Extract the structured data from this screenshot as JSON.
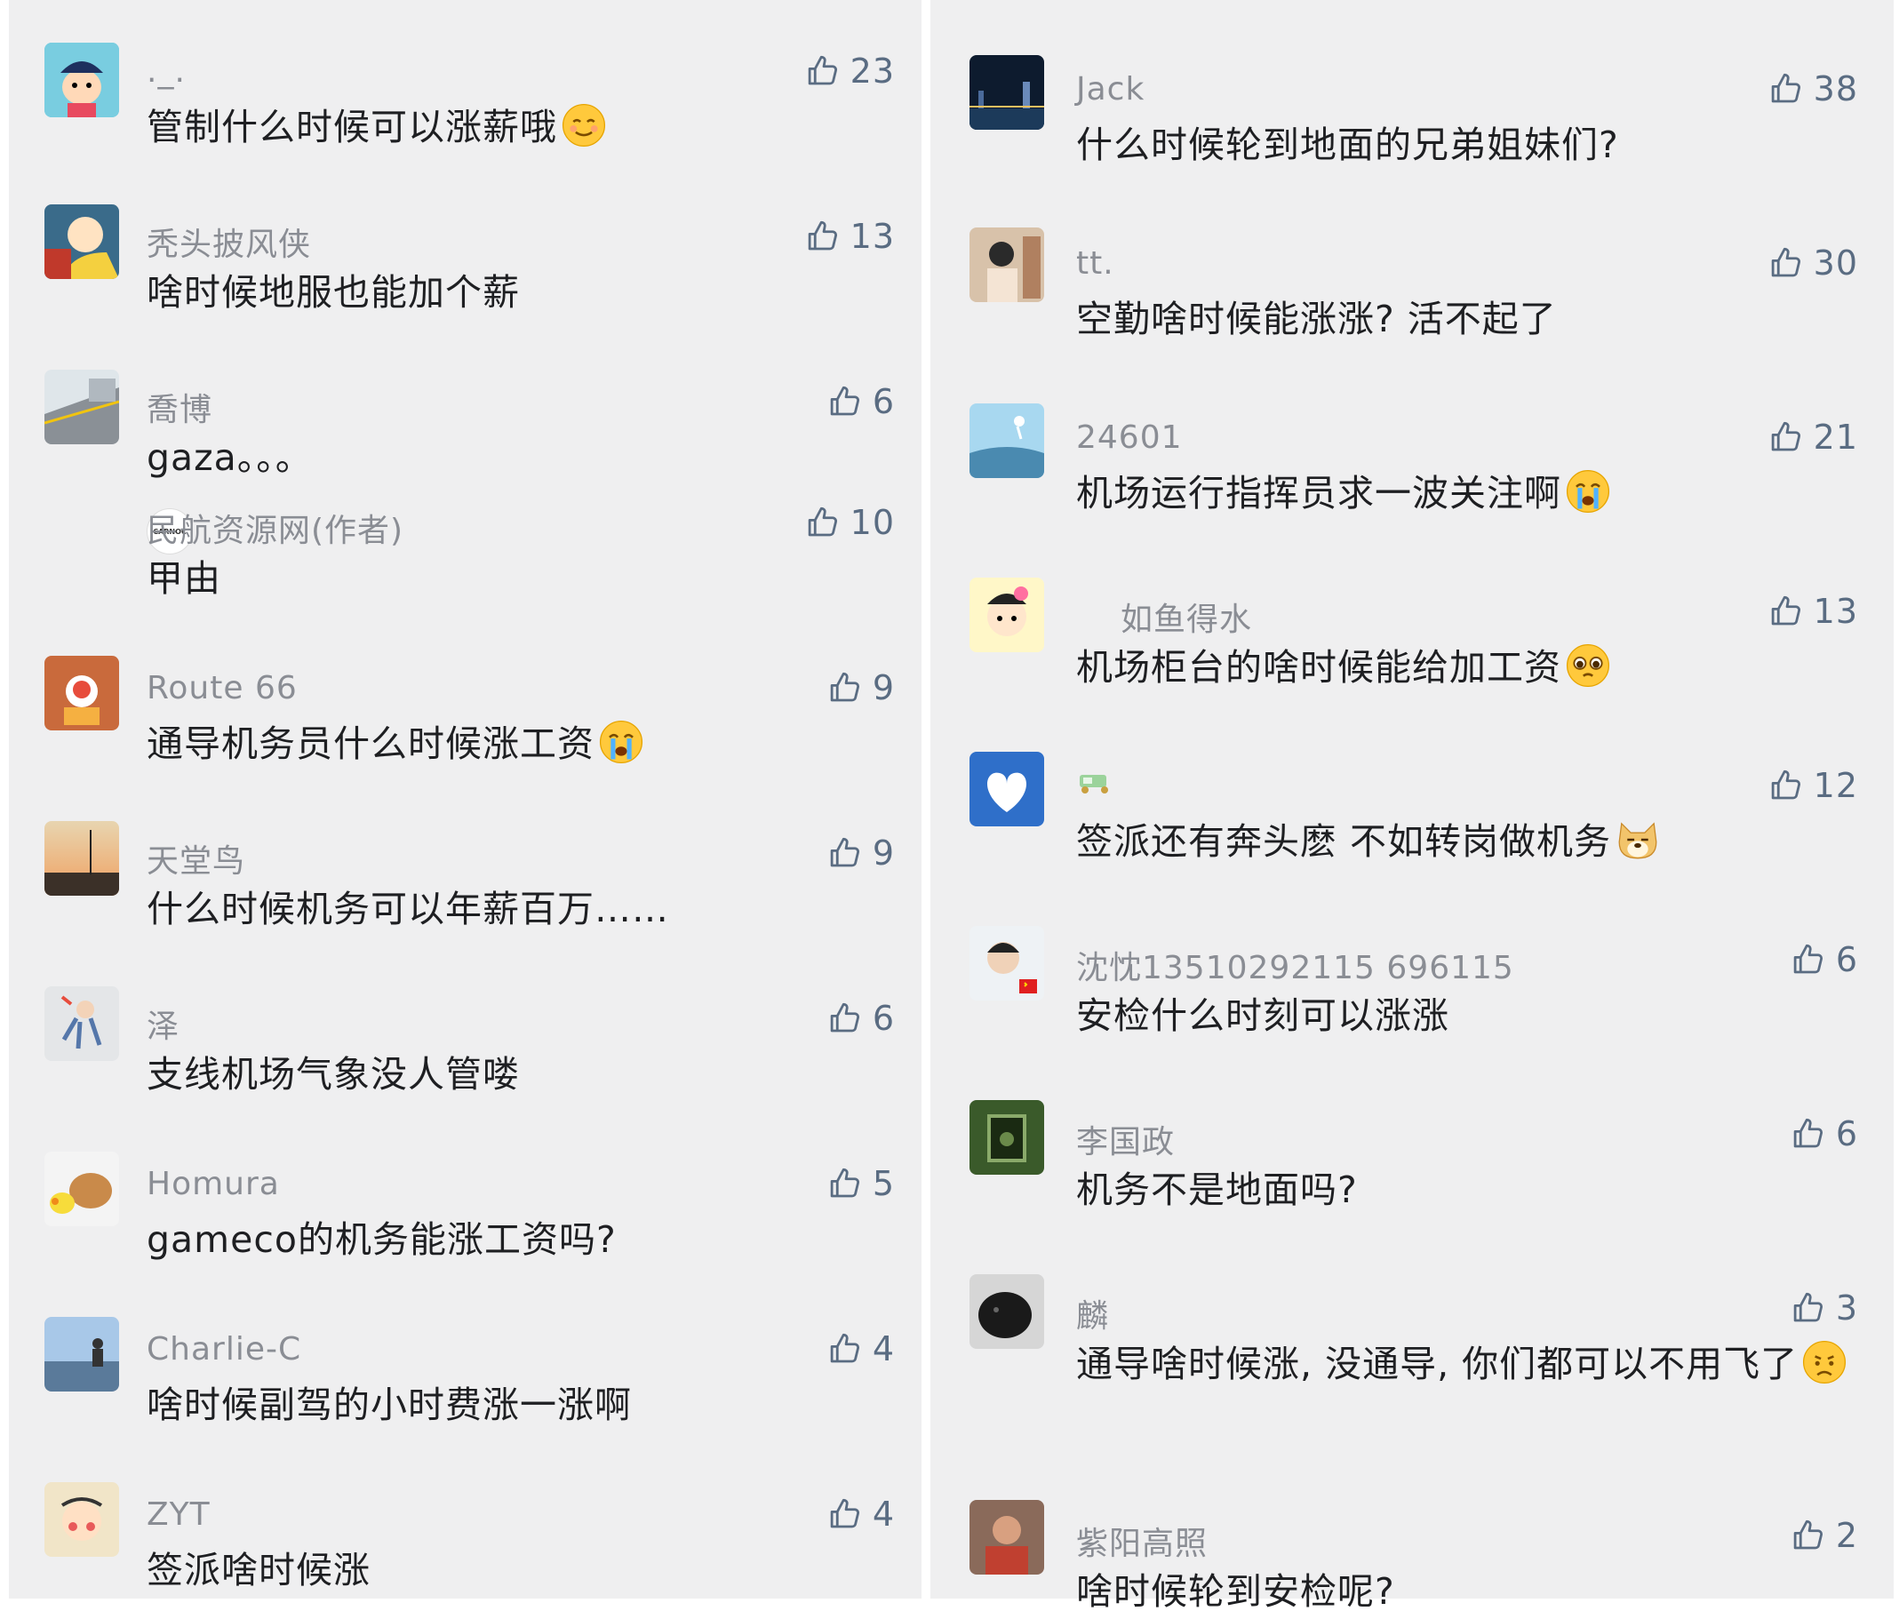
{
  "left_comments": [
    {
      "name": "._.",
      "text": "管制什么时候可以涨薪哦",
      "likes": "23",
      "emoji": "smile-tear-emoji"
    },
    {
      "name": "秃头披风侠",
      "text": "啥时候地服也能加个薪",
      "likes": "13"
    },
    {
      "name": "喬博",
      "text": "gaza。。。",
      "likes": "6"
    },
    {
      "name": "Route 66",
      "text": "通导机务员什么时候涨工资",
      "likes": "9",
      "emoji": "crying-emoji"
    },
    {
      "name": "天堂鸟",
      "text": "什么时候机务可以年薪百万……",
      "likes": "9"
    },
    {
      "name": "泽",
      "text": "支线机场气象没人管喽",
      "likes": "6"
    },
    {
      "name": "Homura",
      "text": "gameco的机务能涨工资吗?",
      "likes": "5"
    },
    {
      "name": "Charlie-C",
      "text": "啥时候副驾的小时费涨一涨啊",
      "likes": "4"
    },
    {
      "name": "ZYT",
      "text": "签派啥时候涨",
      "likes": "4"
    }
  ],
  "reply": {
    "name": "民航资源网(作者)",
    "text": "甲由",
    "likes": "10",
    "avatar_text": "CARNOC"
  },
  "right_comments": [
    {
      "name": "Jack",
      "text": "什么时候轮到地面的兄弟姐妹们?",
      "likes": "38"
    },
    {
      "name": "tt.",
      "text": "空勤啥时候能涨涨? 活不起了",
      "likes": "30"
    },
    {
      "name": "24601",
      "text": "机场运行指挥员求一波关注啊",
      "likes": "21",
      "emoji": "crying-emoji"
    },
    {
      "name": "如鱼得水",
      "text": "机场柜台的啥时候能给加工资",
      "likes": "13",
      "emoji": "pleading-emoji"
    },
    {
      "name": "",
      "text": "签派还有奔头麽  不如转岗做机务",
      "likes": "12",
      "emoji": "doge-emoji"
    },
    {
      "name": "沈忱13510292115 696115",
      "text": "安检什么时刻可以涨涨",
      "likes": "6"
    },
    {
      "name": "李国政",
      "text": "机务不是地面吗?",
      "likes": "6"
    },
    {
      "name": "麟",
      "text": "通导啥时候涨, 没通导, 你们都可以不用飞了",
      "likes": "3",
      "emoji": "sad-emoji"
    },
    {
      "name": "紫阳高照",
      "text": "啥时候轮到安检呢?",
      "likes": "2"
    }
  ],
  "colors": {
    "panel_bg": "#efeff0",
    "name": "#8a8d94",
    "text": "#1e1f22",
    "like": "#5a6c82"
  }
}
